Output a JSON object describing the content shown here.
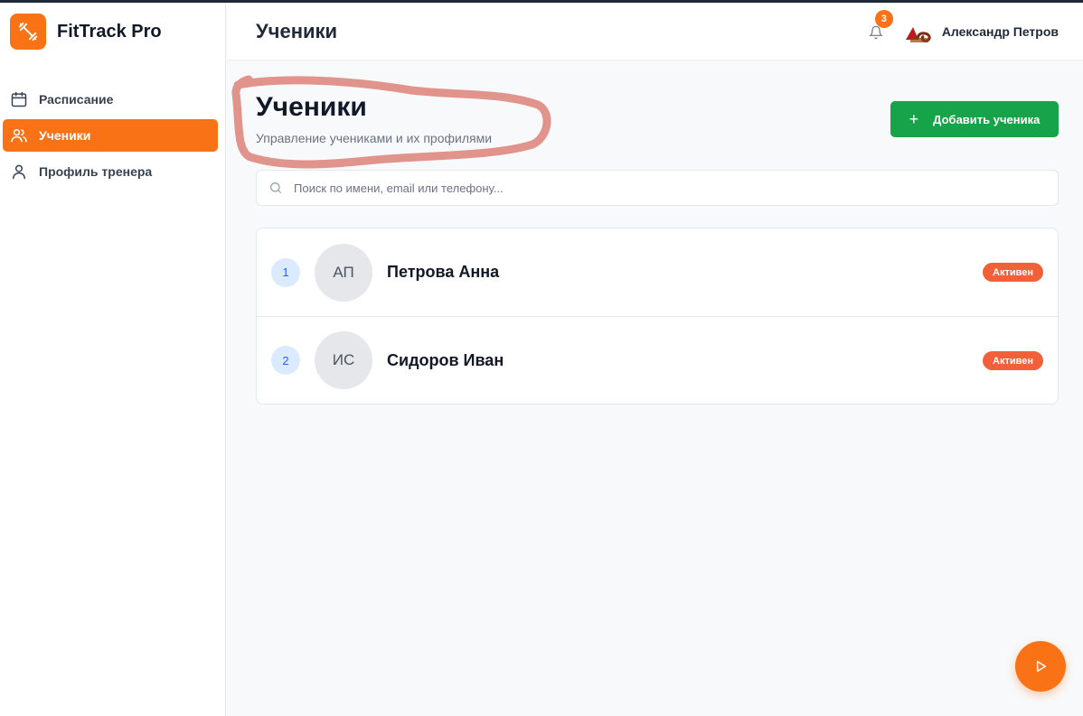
{
  "brand": {
    "name": "FitTrack Pro",
    "icon": "dumbbell-icon",
    "color": "#f97316"
  },
  "sidebar": {
    "items": [
      {
        "label": "Расписание",
        "icon": "calendar-icon",
        "active": false
      },
      {
        "label": "Ученики",
        "icon": "users-icon",
        "active": true
      },
      {
        "label": "Профиль тренера",
        "icon": "user-icon",
        "active": false
      }
    ]
  },
  "header": {
    "title": "Ученики",
    "notifications_count": "3",
    "user_name": "Александр Петров"
  },
  "page": {
    "title": "Ученики",
    "subtitle": "Управление учениками и их профилями",
    "add_button_label": "Добавить ученика"
  },
  "search": {
    "placeholder": "Поиск по имени, email или телефону...",
    "value": ""
  },
  "students": [
    {
      "index": "1",
      "initials": "АП",
      "name": "Петрова Анна",
      "status": "Активен"
    },
    {
      "index": "2",
      "initials": "ИС",
      "name": "Сидоров Иван",
      "status": "Активен"
    }
  ],
  "colors": {
    "accent": "#f97316",
    "success": "#16a34a",
    "status_active": "#f2603a",
    "index_bg": "#dbeafe"
  }
}
